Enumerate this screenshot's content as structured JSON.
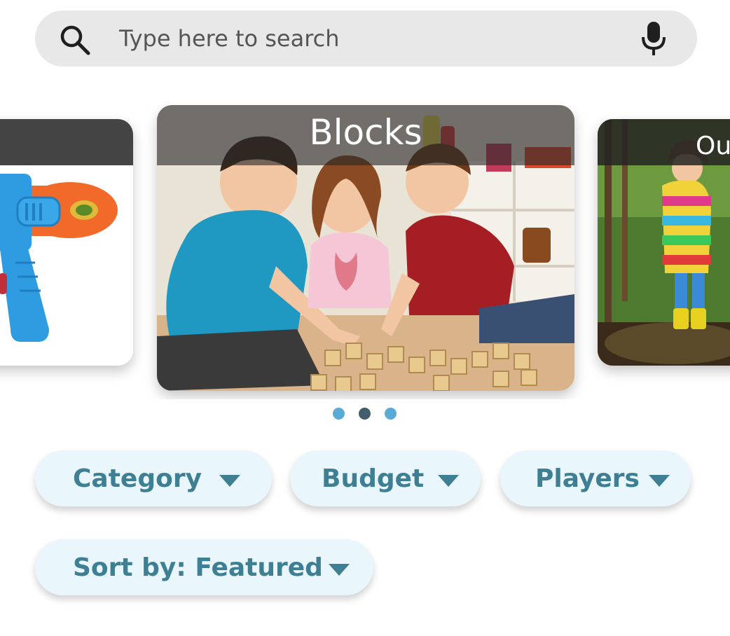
{
  "search": {
    "placeholder": "Type here to search",
    "value": "",
    "search_icon": "search-icon",
    "mic_icon": "microphone-icon"
  },
  "carousel": {
    "cards": [
      {
        "title": "",
        "image": "toy water gun"
      },
      {
        "title": "Blocks",
        "image": "kids playing with alphabet blocks"
      },
      {
        "title": "Ou",
        "image": "child in rainbow raincoat outdoors"
      }
    ],
    "active_index": 1,
    "dot_colors": {
      "active": "#425e6c",
      "inactive": "#5aaad6"
    }
  },
  "filters": {
    "category": {
      "label": "Category",
      "icon": "caret-down-icon"
    },
    "budget": {
      "label": "Budget",
      "icon": "caret-down-icon"
    },
    "players": {
      "label": "Players",
      "icon": "caret-down-icon"
    },
    "sort": {
      "label": "Sort by: Featured",
      "icon": "caret-down-icon"
    }
  },
  "colors": {
    "search_bg": "#e8e8e8",
    "chip_bg": "#e9f6fb",
    "chip_text": "#3e7f93"
  }
}
